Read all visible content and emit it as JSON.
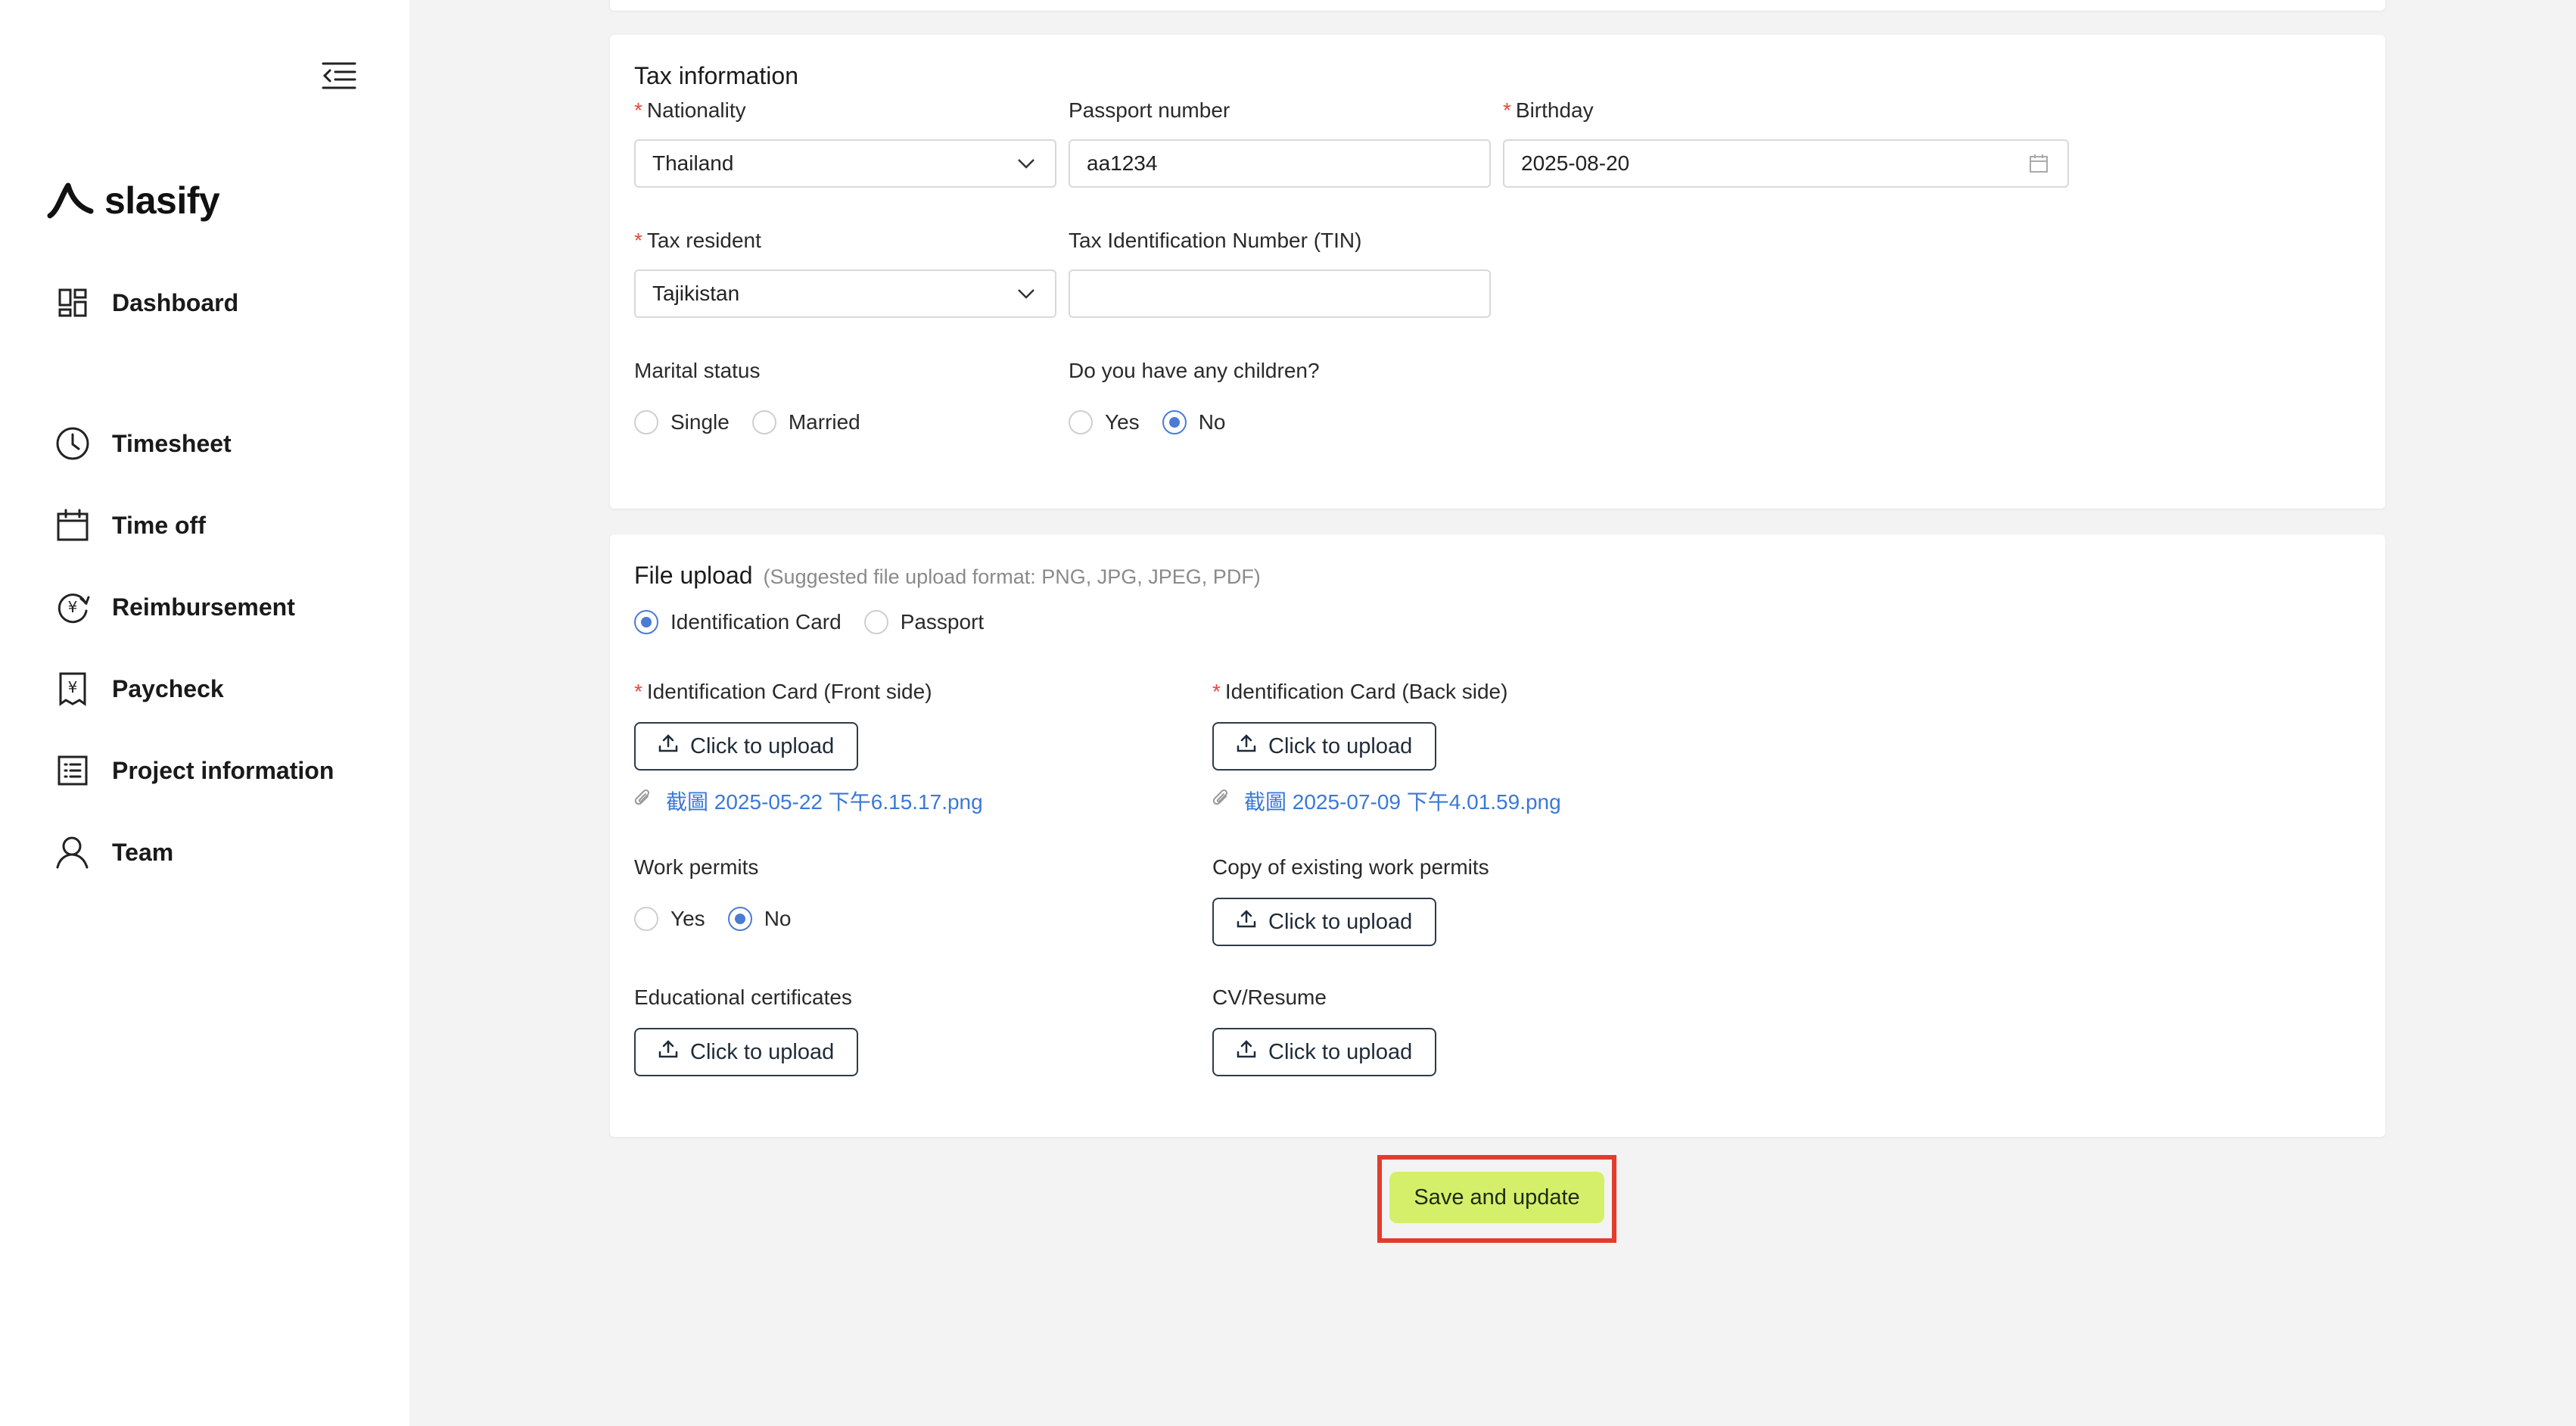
{
  "app": {
    "name": "slasify"
  },
  "sidebar": {
    "items": [
      {
        "label": "Dashboard",
        "icon": "dashboard-icon"
      },
      {
        "label": "Timesheet",
        "icon": "clock-icon"
      },
      {
        "label": "Time off",
        "icon": "calendar-icon"
      },
      {
        "label": "Reimbursement",
        "icon": "yen-refresh-icon"
      },
      {
        "label": "Paycheck",
        "icon": "yen-document-icon"
      },
      {
        "label": "Project information",
        "icon": "list-document-icon"
      },
      {
        "label": "Team",
        "icon": "user-icon"
      }
    ]
  },
  "tax": {
    "title": "Tax information",
    "nationality": {
      "label": "Nationality",
      "value": "Thailand"
    },
    "passport": {
      "label": "Passport number",
      "value": "aa1234"
    },
    "birthday": {
      "label": "Birthday",
      "value": "2025-08-20"
    },
    "tax_resident": {
      "label": "Tax resident",
      "value": "Tajikistan"
    },
    "tin": {
      "label": "Tax Identification Number (TIN)",
      "value": ""
    },
    "marital": {
      "label": "Marital status",
      "options": [
        "Single",
        "Married"
      ],
      "selected": ""
    },
    "children": {
      "label": "Do you have any children?",
      "options": [
        "Yes",
        "No"
      ],
      "selected": "No"
    }
  },
  "upload": {
    "title": "File upload",
    "hint": "(Suggested file upload format: PNG, JPG, JPEG, PDF)",
    "doc_type": {
      "options": [
        "Identification Card",
        "Passport"
      ],
      "selected": "Identification Card"
    },
    "button_label": "Click to upload",
    "id_front": {
      "label": "Identification Card (Front side)",
      "file": "截圖 2025-05-22 下午6.15.17.png"
    },
    "id_back": {
      "label": "Identification Card (Back side)",
      "file": "截圖 2025-07-09 下午4.01.59.png"
    },
    "work_permits": {
      "label": "Work permits",
      "options": [
        "Yes",
        "No"
      ],
      "selected": "No"
    },
    "work_permits_copy": {
      "label": "Copy of existing work permits"
    },
    "edu_certs": {
      "label": "Educational certificates"
    },
    "cv": {
      "label": "CV/Resume"
    }
  },
  "actions": {
    "save_label": "Save and update"
  },
  "colors": {
    "accent": "#4a7bd5",
    "save": "#d5ef6a",
    "highlight": "#e33c2c",
    "link": "#3b78d8",
    "required": "#e5483b"
  }
}
